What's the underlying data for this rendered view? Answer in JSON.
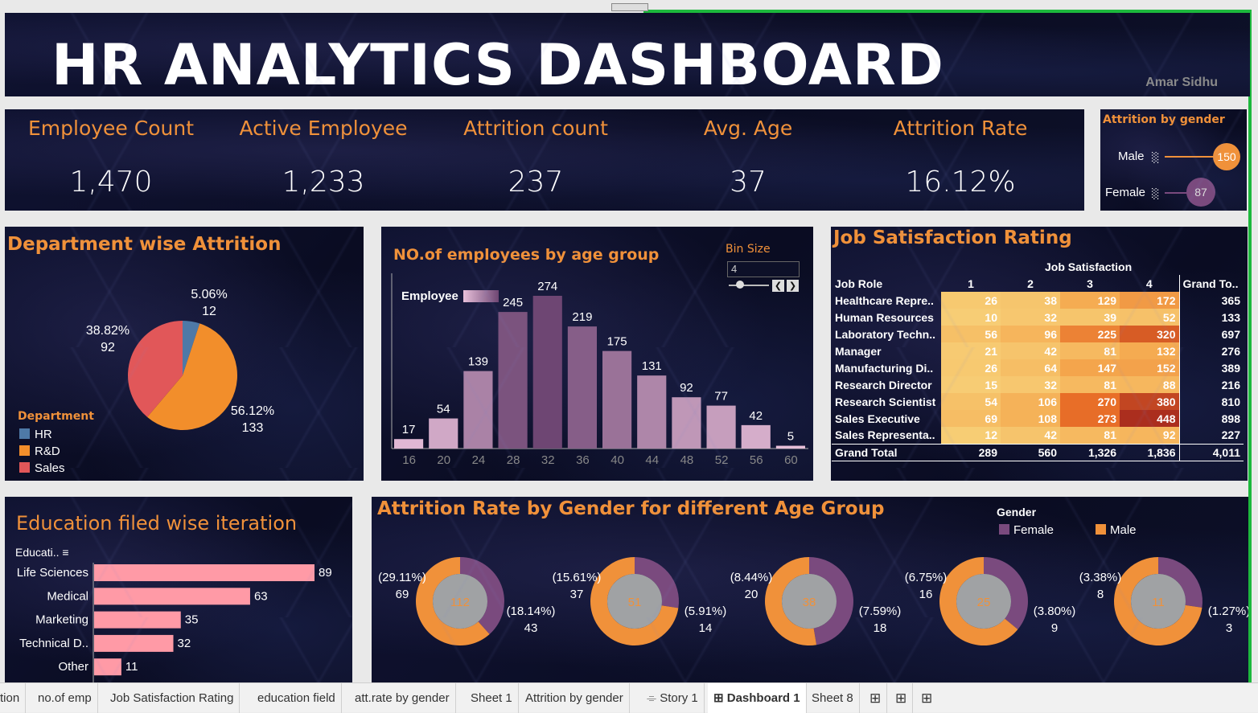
{
  "header": {
    "title": "HR ANALYTICS DASHBOARD",
    "author": "Amar Sidhu"
  },
  "kpis": [
    {
      "label": "Employee Count",
      "value": "1,470"
    },
    {
      "label": "Active Employee",
      "value": "1,233"
    },
    {
      "label": "Attrition count",
      "value": "237"
    },
    {
      "label": "Avg. Age",
      "value": "37"
    },
    {
      "label": "Attrition Rate",
      "value": "16.12%"
    }
  ],
  "gender_attrition": {
    "title": "Attrition by gender",
    "rows": [
      {
        "label": "Male",
        "value": "150"
      },
      {
        "label": "Female",
        "value": "87"
      }
    ],
    "colors": {
      "male": "#f0913a",
      "female": "#7a4a7e"
    }
  },
  "dept": {
    "title": "Department wise Attrition",
    "legend_title": "Department",
    "chart_data": {
      "type": "pie",
      "slices": [
        {
          "name": "HR",
          "pct": 5.06,
          "count": 12,
          "color": "#4e79a7"
        },
        {
          "name": "R&D",
          "pct": 56.12,
          "count": 133,
          "color": "#f28e2b"
        },
        {
          "name": "Sales",
          "pct": 38.82,
          "count": 92,
          "color": "#e15759"
        }
      ]
    },
    "labels": {
      "hr_pct": "5.06%",
      "hr_cnt": "12",
      "rd_pct": "56.12%",
      "rd_cnt": "133",
      "sales_pct": "38.82%",
      "sales_cnt": "92"
    }
  },
  "age": {
    "title": "NO.of employees by age group",
    "legend_label": "Employee",
    "bin_label": "Bin Size",
    "bin_value": "4",
    "chart_data": {
      "type": "bar",
      "categories": [
        "16",
        "20",
        "24",
        "28",
        "32",
        "36",
        "40",
        "44",
        "48",
        "52",
        "56",
        "60"
      ],
      "values": [
        17,
        54,
        139,
        245,
        274,
        219,
        175,
        131,
        92,
        77,
        42,
        5
      ]
    }
  },
  "job": {
    "title": "Job Satisfaction Rating",
    "col_header": "Job Satisfaction",
    "row_header": "Job Role",
    "columns": [
      "1",
      "2",
      "3",
      "4",
      "Grand To.."
    ],
    "rows": [
      {
        "role": "Healthcare Repre..",
        "v": [
          "26",
          "38",
          "129",
          "172"
        ],
        "t": "365"
      },
      {
        "role": "Human Resources",
        "v": [
          "10",
          "32",
          "39",
          "52"
        ],
        "t": "133"
      },
      {
        "role": "Laboratory Techn..",
        "v": [
          "56",
          "96",
          "225",
          "320"
        ],
        "t": "697"
      },
      {
        "role": "Manager",
        "v": [
          "21",
          "42",
          "81",
          "132"
        ],
        "t": "276"
      },
      {
        "role": "Manufacturing Di..",
        "v": [
          "26",
          "64",
          "147",
          "152"
        ],
        "t": "389"
      },
      {
        "role": "Research Director",
        "v": [
          "15",
          "32",
          "81",
          "88"
        ],
        "t": "216"
      },
      {
        "role": "Research Scientist",
        "v": [
          "54",
          "106",
          "270",
          "380"
        ],
        "t": "810"
      },
      {
        "role": "Sales Executive",
        "v": [
          "69",
          "108",
          "273",
          "448"
        ],
        "t": "898"
      },
      {
        "role": "Sales Representa..",
        "v": [
          "12",
          "42",
          "81",
          "92"
        ],
        "t": "227"
      }
    ],
    "grand": {
      "role": "Grand Total",
      "v": [
        "289",
        "560",
        "1,326",
        "1,836"
      ],
      "t": "4,011"
    }
  },
  "edu": {
    "title": "Education filed wise iteration",
    "field_label": "Educati..",
    "chart_data": {
      "type": "bar",
      "categories": [
        "Life Sciences",
        "Medical",
        "Marketing",
        "Technical D..",
        "Other"
      ],
      "values": [
        89,
        63,
        35,
        32,
        11
      ]
    }
  },
  "donut": {
    "title": "Attrition Rate  by Gender for different Age Group",
    "legend_title": "Gender",
    "legend": [
      {
        "name": "Female",
        "color": "#7a4a7e"
      },
      {
        "name": "Male",
        "color": "#f0913a"
      }
    ],
    "groups": [
      {
        "total": "112",
        "l1": "(29.11%)",
        "l2": "69",
        "r1": "(18.14%)",
        "r2": "43",
        "male": 69,
        "female": 43
      },
      {
        "total": "51",
        "l1": "(15.61%)",
        "l2": "37",
        "r1": "(5.91%)",
        "r2": "14",
        "male": 37,
        "female": 14
      },
      {
        "total": "38",
        "l1": "(8.44%)",
        "l2": "20",
        "r1": "(7.59%)",
        "r2": "18",
        "male": 20,
        "female": 18
      },
      {
        "total": "25",
        "l1": "(6.75%)",
        "l2": "16",
        "r1": "(3.80%)",
        "r2": "9",
        "male": 16,
        "female": 9
      },
      {
        "total": "11",
        "l1": "(3.38%)",
        "l2": "8",
        "r1": "(1.27%)",
        "r2": "3",
        "male": 8,
        "female": 3
      }
    ]
  },
  "tabs": [
    "tion",
    "no.of emp",
    "Job Satisfaction Rating",
    "education field",
    "att.rate by gender",
    "Sheet 1",
    "Attrition by gender",
    "Story 1",
    "Dashboard 1",
    "Sheet 8"
  ]
}
